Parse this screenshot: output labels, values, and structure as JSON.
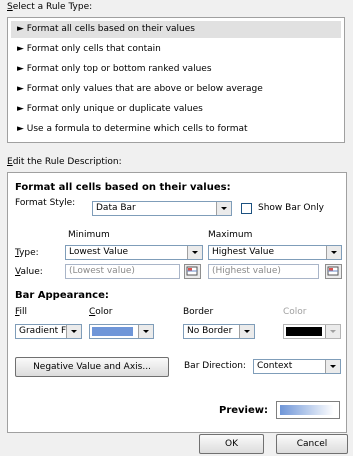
{
  "select_rule_label": "Select a Rule Type:",
  "rule_types": [
    "► Format all cells based on their values",
    "► Format only cells that contain",
    "► Format only top or bottom ranked values",
    "► Format only values that are above or below average",
    "► Format only unique or duplicate values",
    "► Use a formula to determine which cells to format"
  ],
  "edit_desc_label": "Edit the Rule Description:",
  "desc": {
    "heading": "Format all cells based on their values:",
    "format_style_label": "Format Style:",
    "format_style_value": "Data Bar",
    "show_bar_only_label": "Show Bar Only",
    "minimum_header": "Minimum",
    "maximum_header": "Maximum",
    "type_label": "Type:",
    "min_type": "Lowest Value",
    "max_type": "Highest Value",
    "value_label": "Value:",
    "min_value_placeholder": "(Lowest value)",
    "max_value_placeholder": "(Highest value)",
    "bar_appearance_heading": "Bar Appearance:",
    "fill_label": "Fill",
    "fill_value": "Gradient Fill",
    "color_label": "Color",
    "fill_color": "#6f96d8",
    "border_label": "Border",
    "border_value": "No Border",
    "border_color_label": "Color",
    "border_color": "#000000",
    "negative_button": "Negative Value and Axis...",
    "bar_direction_label": "Bar Direction:",
    "bar_direction_value": "Context",
    "preview_label": "Preview:"
  },
  "ok_label": "OK",
  "cancel_label": "Cancel"
}
